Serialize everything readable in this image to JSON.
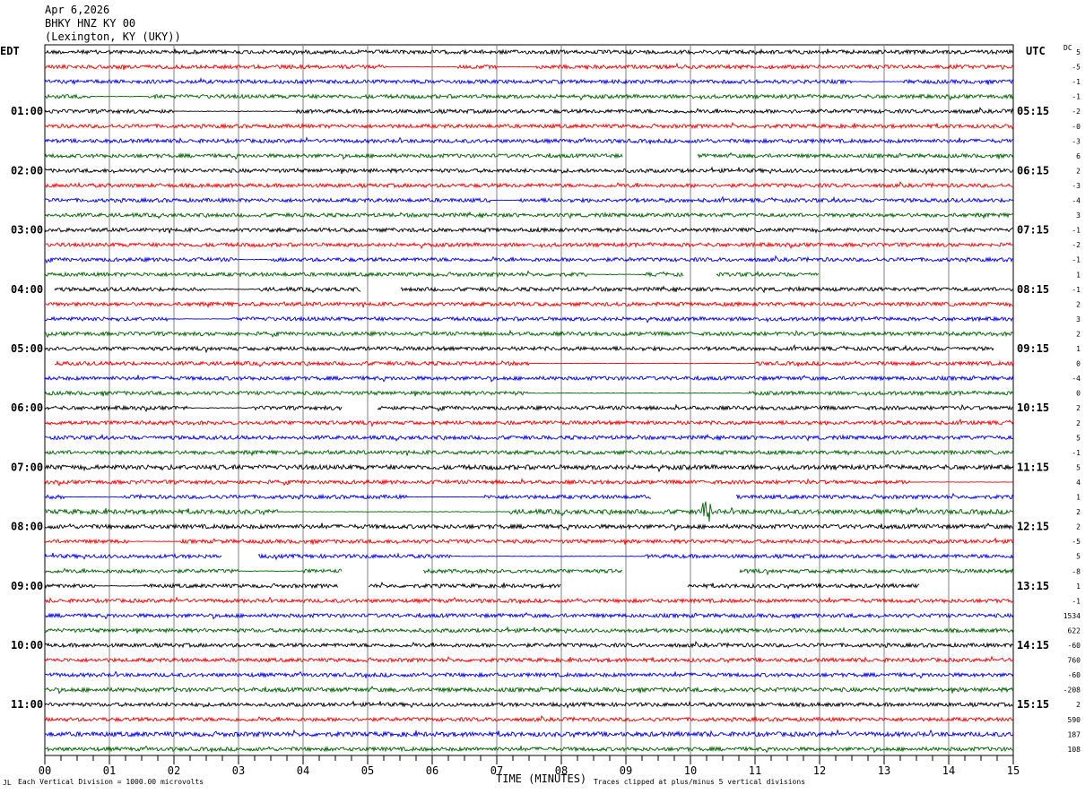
{
  "header": {
    "date": "Apr 6,2026",
    "station": "BHKY HNZ KY 00",
    "location": "(Lexington, KY (UKY))"
  },
  "left_zone": "EDT",
  "right_zone": "UTC",
  "dc_label": "DC",
  "footer": {
    "division_note": "Each Vertical Division = 1000.00 microvolts",
    "clip_note": "Traces clipped at plus/minus 5 vertical divisions",
    "mark": "JL"
  },
  "colors": {
    "trace_cycle": [
      "#000000",
      "#ff0000",
      "#0000ff",
      "#006400"
    ],
    "grid": "#808080"
  },
  "chart_data": {
    "type": "helicorder",
    "xlabel": "TIME (MINUTES)",
    "x_ticks": [
      "00",
      "01",
      "02",
      "03",
      "04",
      "05",
      "06",
      "07",
      "08",
      "09",
      "10",
      "11",
      "12",
      "13",
      "14",
      "15"
    ],
    "xlim": [
      0,
      15
    ],
    "minutes_per_line": 15,
    "left_time_labels": [
      "01:00",
      "02:00",
      "03:00",
      "04:00",
      "05:00",
      "06:00",
      "07:00",
      "08:00",
      "09:00",
      "10:00",
      "11:00"
    ],
    "right_time_labels": [
      "05:15",
      "06:15",
      "07:15",
      "08:15",
      "09:15",
      "10:15",
      "11:15",
      "12:15",
      "13:15",
      "14:15",
      "15:15"
    ],
    "label_every_n_lines": 4,
    "first_labeled_line": 4,
    "dc_offsets": [
      "5",
      "-5",
      "-1",
      "-1",
      "-2",
      "-0",
      "-3",
      "6",
      "2",
      "-3",
      "-4",
      "3",
      "-1",
      "-2",
      "-1",
      "1",
      "-1",
      "2",
      "3",
      "2",
      "1",
      "0",
      "-4",
      "0",
      "2",
      "2",
      "5",
      "-1",
      "5",
      "4",
      "1",
      "2",
      "2",
      "-5",
      "5",
      "-8",
      "1",
      "-1",
      "1534",
      "622",
      "-60",
      "760",
      "-60",
      "-208",
      "2",
      "590",
      "187",
      "108"
    ],
    "traces": [
      {
        "amp": 1.0,
        "gaps": []
      },
      {
        "amp": 1.0,
        "gaps": [
          [
            5.3,
            6.4
          ],
          [
            7.0,
            7.6
          ]
        ]
      },
      {
        "amp": 1.0,
        "gaps": [
          [
            12.5,
            13.3
          ]
        ]
      },
      {
        "amp": 1.0,
        "gaps": [
          [
            0.7,
            1.6
          ]
        ]
      },
      {
        "amp": 1.0,
        "gaps": [
          [
            2.0,
            3.9
          ]
        ]
      },
      {
        "amp": 1.0,
        "gaps": []
      },
      {
        "amp": 1.0,
        "gaps": []
      },
      {
        "amp": 1.0,
        "gaps": [],
        "missing": [
          [
            8.95,
            10.1
          ]
        ]
      },
      {
        "amp": 1.0,
        "gaps": []
      },
      {
        "amp": 1.0,
        "gaps": []
      },
      {
        "amp": 1.0,
        "gaps": [
          [
            6.9,
            7.3
          ]
        ]
      },
      {
        "amp": 1.0,
        "gaps": []
      },
      {
        "amp": 1.0,
        "gaps": []
      },
      {
        "amp": 1.0,
        "gaps": []
      },
      {
        "amp": 1.0,
        "gaps": [
          [
            3.0,
            3.5
          ]
        ]
      },
      {
        "amp": 1.0,
        "gaps": [
          [
            8.4,
            9.3
          ]
        ],
        "missing": [
          [
            9.9,
            10.4
          ],
          [
            12.0,
            15
          ]
        ]
      },
      {
        "amp": 1.0,
        "gaps": [
          [
            2.5,
            3.3
          ]
        ],
        "missing": [
          [
            0,
            0.15
          ],
          [
            4.9,
            5.5
          ]
        ]
      },
      {
        "amp": 1.0,
        "gaps": []
      },
      {
        "amp": 1.0,
        "gaps": [
          [
            1.9,
            2.9
          ]
        ]
      },
      {
        "amp": 1.0,
        "gaps": []
      },
      {
        "amp": 1.0,
        "gaps": [],
        "missing": [
          [
            14.7,
            15
          ]
        ]
      },
      {
        "amp": 1.0,
        "gaps": [
          [
            7.5,
            11.0
          ]
        ],
        "missing": [
          [
            0,
            0.15
          ]
        ]
      },
      {
        "amp": 1.0,
        "gaps": []
      },
      {
        "amp": 1.0,
        "gaps": [
          [
            7.5,
            10.9
          ]
        ]
      },
      {
        "amp": 1.0,
        "gaps": [
          [
            2.2,
            3.2
          ]
        ],
        "missing": [
          [
            4.6,
            5.15
          ]
        ]
      },
      {
        "amp": 1.0,
        "gaps": []
      },
      {
        "amp": 1.0,
        "gaps": []
      },
      {
        "amp": 1.0,
        "gaps": []
      },
      {
        "amp": 1.2,
        "gaps": []
      },
      {
        "amp": 1.0,
        "gaps": [
          [
            13.4,
            15
          ]
        ]
      },
      {
        "amp": 1.0,
        "gaps": [
          [
            0.3,
            1.2
          ],
          [
            5.6,
            6.8
          ]
        ],
        "missing": [
          [
            9.4,
            10.7
          ]
        ]
      },
      {
        "amp": 1.2,
        "gaps": [
          [
            3.6,
            7.2
          ]
        ],
        "event": 10.25
      },
      {
        "amp": 1.1,
        "gaps": []
      },
      {
        "amp": 1.0,
        "gaps": [
          [
            1.3,
            2.1
          ]
        ]
      },
      {
        "amp": 1.0,
        "gaps": [
          [
            6.3,
            9.3
          ]
        ],
        "missing": [
          [
            2.75,
            3.3
          ]
        ]
      },
      {
        "amp": 1.0,
        "gaps": [
          [
            3.0,
            4.0
          ]
        ],
        "missing": [
          [
            4.6,
            5.85
          ],
          [
            8.95,
            10.75
          ]
        ]
      },
      {
        "amp": 1.0,
        "gaps": [
          [
            0.8,
            1.5
          ]
        ],
        "missing": [
          [
            4.55,
            5.0
          ],
          [
            8.0,
            9.95
          ],
          [
            13.55,
            15
          ]
        ]
      },
      {
        "amp": 1.0,
        "gaps": []
      },
      {
        "amp": 1.0,
        "gaps": []
      },
      {
        "amp": 1.0,
        "gaps": []
      },
      {
        "amp": 1.0,
        "gaps": []
      },
      {
        "amp": 1.0,
        "gaps": []
      },
      {
        "amp": 1.0,
        "gaps": []
      },
      {
        "amp": 1.1,
        "gaps": []
      },
      {
        "amp": 1.0,
        "gaps": []
      },
      {
        "amp": 1.0,
        "gaps": []
      },
      {
        "amp": 1.2,
        "gaps": []
      },
      {
        "amp": 1.0,
        "gaps": []
      }
    ]
  }
}
